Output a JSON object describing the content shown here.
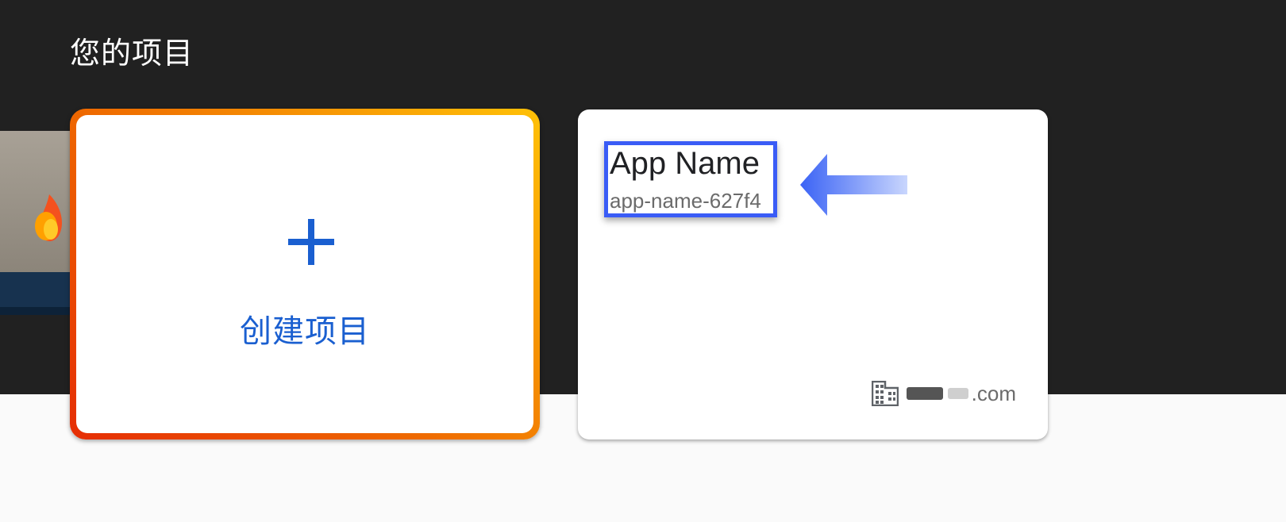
{
  "header": {
    "title": "您的项目"
  },
  "create_card": {
    "label": "创建项目",
    "icon": "plus-icon",
    "border_gradient": [
      "#e52d05",
      "#ef6c00",
      "#ffc107"
    ],
    "accent_color": "#1a5fd0"
  },
  "project_card": {
    "name": "App Name",
    "project_id": "app-name-627f4",
    "org_icon": "building-icon",
    "org_domain_suffix": ".com",
    "highlight_color": "#3a5cf6"
  },
  "annotations": {
    "arrow": "arrow-left-icon"
  },
  "colors": {
    "header_bg": "#212121",
    "page_bg": "#fafafa"
  }
}
